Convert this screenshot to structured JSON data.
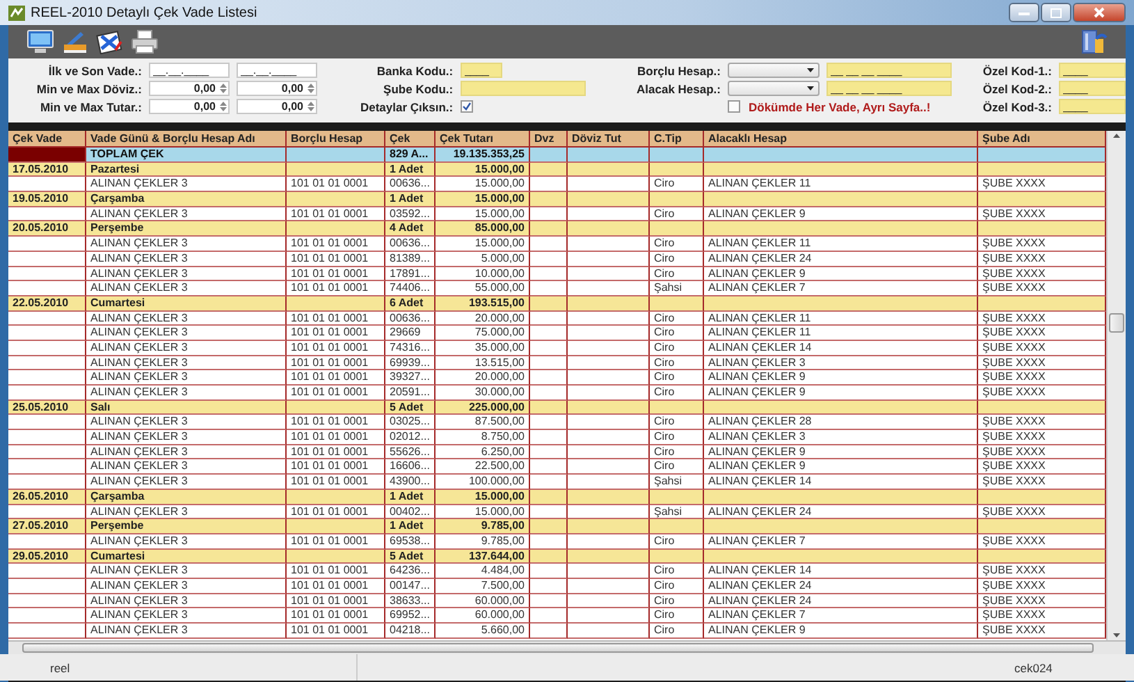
{
  "window": {
    "title": "REEL-2010 Detaylı Çek Vade Listesi"
  },
  "filters": {
    "ranges": [
      {
        "label": "İlk ve Son Vade.:",
        "kind": "date",
        "values": [
          "__.__.____",
          "__.__.____"
        ]
      },
      {
        "label": "Min ve Max Döviz.:",
        "kind": "spin",
        "values": [
          "0,00",
          "0,00"
        ]
      },
      {
        "label": "Min ve Max Tutar.:",
        "kind": "spin",
        "values": [
          "0,00",
          "0,00"
        ]
      }
    ],
    "bank_code": {
      "label": "Banka Kodu.:",
      "value": "____"
    },
    "branch_code": {
      "label": "Şube Kodu.:"
    },
    "details": {
      "label": "Detaylar Çıksın.:",
      "checked": true
    },
    "accounts": [
      {
        "label": "Borçlu Hesap.:",
        "code": "__ __ __ ____"
      },
      {
        "label": "Alacak Hesap.:",
        "code": "__ __ __ ____"
      }
    ],
    "page_per_due": {
      "label": "Dökümde Her Vade, Ayrı Sayfa..!",
      "checked": false
    },
    "special_codes": [
      {
        "label": "Özel Kod-1.:",
        "value": "____"
      },
      {
        "label": "Özel Kod-2.:",
        "value": "____"
      },
      {
        "label": "Özel Kod-3.:",
        "value": "____"
      }
    ]
  },
  "table": {
    "columns": [
      "Çek Vade",
      "Vade Günü & Borçlu Hesap Adı",
      "Borçlu Hesap",
      "Çek",
      "Çek Tutarı",
      "Dvz",
      "Döviz Tut",
      "C.Tip",
      "Alacaklı Hesap",
      "Şube Adı"
    ],
    "total": {
      "label": "TOPLAM ÇEK",
      "count": "829 A...",
      "amount": "19.135.353,25"
    },
    "groups": [
      {
        "date": "17.05.2010",
        "day": "Pazartesi",
        "count": "1 Adet",
        "amount": "15.000,00",
        "rows": [
          [
            "ALINAN ÇEKLER 3",
            "101 01 01 0001",
            "00636...",
            "15.000,00",
            "Ciro",
            "ALINAN ÇEKLER 11",
            "ŞUBE XXXX"
          ]
        ]
      },
      {
        "date": "19.05.2010",
        "day": "Çarşamba",
        "count": "1 Adet",
        "amount": "15.000,00",
        "rows": [
          [
            "ALINAN ÇEKLER 3",
            "101 01 01 0001",
            "03592...",
            "15.000,00",
            "Ciro",
            "ALINAN ÇEKLER 9",
            "ŞUBE XXXX"
          ]
        ]
      },
      {
        "date": "20.05.2010",
        "day": "Perşembe",
        "count": "4 Adet",
        "amount": "85.000,00",
        "rows": [
          [
            "ALINAN ÇEKLER 3",
            "101 01 01 0001",
            "00636...",
            "15.000,00",
            "Ciro",
            "ALINAN ÇEKLER 11",
            "ŞUBE XXXX"
          ],
          [
            "ALINAN ÇEKLER 3",
            "101 01 01 0001",
            "81389...",
            "5.000,00",
            "Ciro",
            "ALINAN ÇEKLER 24",
            "ŞUBE XXXX"
          ],
          [
            "ALINAN ÇEKLER 3",
            "101 01 01 0001",
            "17891...",
            "10.000,00",
            "Ciro",
            "ALINAN ÇEKLER 9",
            "ŞUBE XXXX"
          ],
          [
            "ALINAN ÇEKLER 3",
            "101 01 01 0001",
            "74406...",
            "55.000,00",
            "Şahsi",
            "ALINAN ÇEKLER 7",
            "ŞUBE XXXX"
          ]
        ]
      },
      {
        "date": "22.05.2010",
        "day": "Cumartesi",
        "count": "6 Adet",
        "amount": "193.515,00",
        "rows": [
          [
            "ALINAN ÇEKLER 3",
            "101 01 01 0001",
            "00636...",
            "20.000,00",
            "Ciro",
            "ALINAN ÇEKLER 11",
            "ŞUBE XXXX"
          ],
          [
            "ALINAN ÇEKLER 3",
            "101 01 01 0001",
            "29669",
            "75.000,00",
            "Ciro",
            "ALINAN ÇEKLER 11",
            "ŞUBE XXXX"
          ],
          [
            "ALINAN ÇEKLER 3",
            "101 01 01 0001",
            "74316...",
            "35.000,00",
            "Ciro",
            "ALINAN ÇEKLER 14",
            "ŞUBE XXXX"
          ],
          [
            "ALINAN ÇEKLER 3",
            "101 01 01 0001",
            "69939...",
            "13.515,00",
            "Ciro",
            "ALINAN ÇEKLER 3",
            "ŞUBE XXXX"
          ],
          [
            "ALINAN ÇEKLER 3",
            "101 01 01 0001",
            "39327...",
            "20.000,00",
            "Ciro",
            "ALINAN ÇEKLER 9",
            "ŞUBE XXXX"
          ],
          [
            "ALINAN ÇEKLER 3",
            "101 01 01 0001",
            "20591...",
            "30.000,00",
            "Ciro",
            "ALINAN ÇEKLER 9",
            "ŞUBE XXXX"
          ]
        ]
      },
      {
        "date": "25.05.2010",
        "day": "Salı",
        "count": "5 Adet",
        "amount": "225.000,00",
        "rows": [
          [
            "ALINAN ÇEKLER 3",
            "101 01 01 0001",
            "03025...",
            "87.500,00",
            "Ciro",
            "ALINAN ÇEKLER 28",
            "ŞUBE XXXX"
          ],
          [
            "ALINAN ÇEKLER 3",
            "101 01 01 0001",
            "02012...",
            "8.750,00",
            "Ciro",
            "ALINAN ÇEKLER 3",
            "ŞUBE XXXX"
          ],
          [
            "ALINAN ÇEKLER 3",
            "101 01 01 0001",
            "55626...",
            "6.250,00",
            "Ciro",
            "ALINAN ÇEKLER 9",
            "ŞUBE XXXX"
          ],
          [
            "ALINAN ÇEKLER 3",
            "101 01 01 0001",
            "16606...",
            "22.500,00",
            "Ciro",
            "ALINAN ÇEKLER 9",
            "ŞUBE XXXX"
          ],
          [
            "ALINAN ÇEKLER 3",
            "101 01 01 0001",
            "43900...",
            "100.000,00",
            "Şahsi",
            "ALINAN ÇEKLER 14",
            "ŞUBE XXXX"
          ]
        ]
      },
      {
        "date": "26.05.2010",
        "day": "Çarşamba",
        "count": "1 Adet",
        "amount": "15.000,00",
        "rows": [
          [
            "ALINAN ÇEKLER 3",
            "101 01 01 0001",
            "00402...",
            "15.000,00",
            "Şahsi",
            "ALINAN ÇEKLER 24",
            "ŞUBE XXXX"
          ]
        ]
      },
      {
        "date": "27.05.2010",
        "day": "Perşembe",
        "count": "1 Adet",
        "amount": "9.785,00",
        "rows": [
          [
            "ALINAN ÇEKLER 3",
            "101 01 01 0001",
            "69538...",
            "9.785,00",
            "Ciro",
            "ALINAN ÇEKLER 7",
            "ŞUBE XXXX"
          ]
        ]
      },
      {
        "date": "29.05.2010",
        "day": "Cumartesi",
        "count": "5 Adet",
        "amount": "137.644,00",
        "rows": [
          [
            "ALINAN ÇEKLER 3",
            "101 01 01 0001",
            "64236...",
            "4.484,00",
            "Ciro",
            "ALINAN ÇEKLER 14",
            "ŞUBE XXXX"
          ],
          [
            "ALINAN ÇEKLER 3",
            "101 01 01 0001",
            "00147...",
            "7.500,00",
            "Ciro",
            "ALINAN ÇEKLER 24",
            "ŞUBE XXXX"
          ],
          [
            "ALINAN ÇEKLER 3",
            "101 01 01 0001",
            "38633...",
            "60.000,00",
            "Ciro",
            "ALINAN ÇEKLER 24",
            "ŞUBE XXXX"
          ],
          [
            "ALINAN ÇEKLER 3",
            "101 01 01 0001",
            "69952...",
            "60.000,00",
            "Ciro",
            "ALINAN ÇEKLER 7",
            "ŞUBE XXXX"
          ],
          [
            "ALINAN ÇEKLER 3",
            "101 01 01 0001",
            "04218...",
            "5.660,00",
            "Ciro",
            "ALINAN ÇEKLER 9",
            "ŞUBE XXXX"
          ]
        ]
      }
    ]
  },
  "status_bar": {
    "user": "reel",
    "form": "cek024"
  }
}
